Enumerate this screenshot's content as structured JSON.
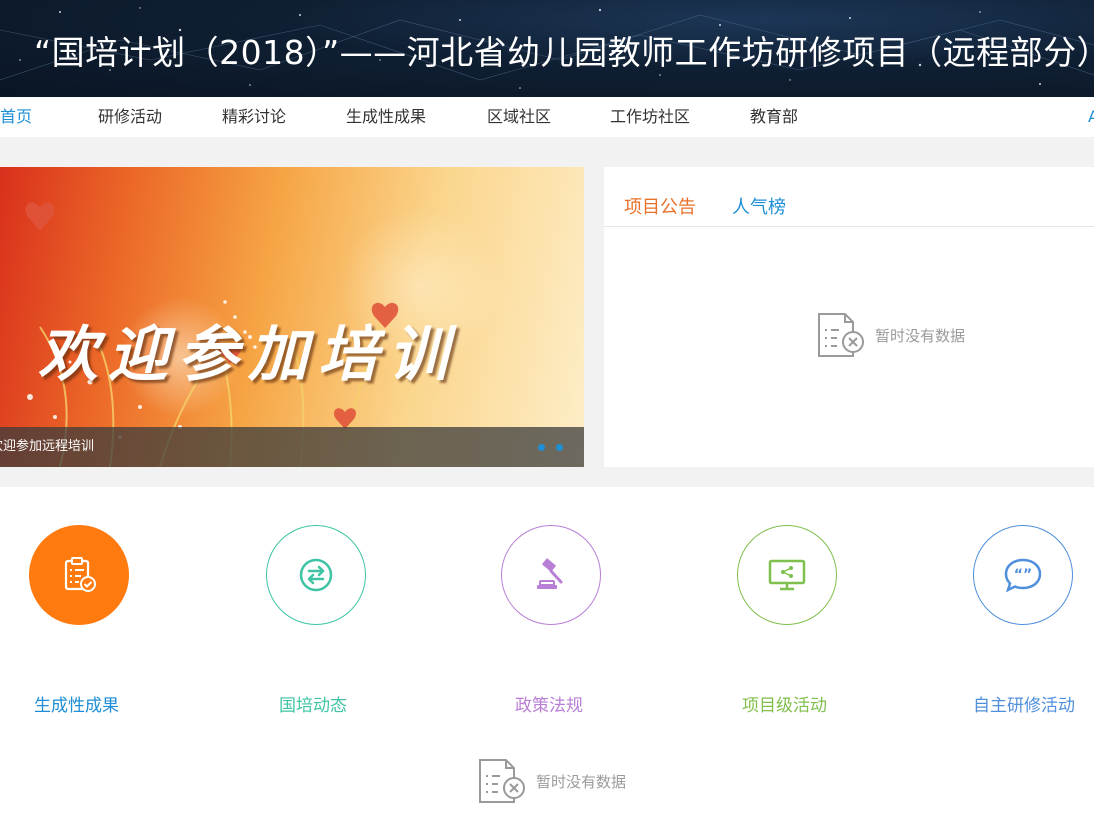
{
  "header": {
    "title": "“国培计划（2018）”——河北省幼儿园教师工作坊研修项目（远程部分）"
  },
  "nav": {
    "items": [
      {
        "label": "项目首页",
        "active": true
      },
      {
        "label": "研修活动"
      },
      {
        "label": "精彩讨论"
      },
      {
        "label": "生成性成果"
      },
      {
        "label": "区域社区"
      },
      {
        "label": "工作坊社区"
      },
      {
        "label": "教育部"
      }
    ],
    "edge_label": "A"
  },
  "banner": {
    "slogan": "欢迎参加培训",
    "caption": "欢迎参加远程培训",
    "slide_count": 2
  },
  "notice": {
    "tabs": [
      "项目公告",
      "人气榜"
    ],
    "active_tab": 0,
    "empty_text": "暂时没有数据"
  },
  "quick_links": [
    {
      "label": "生成性成果",
      "icon": "clipboard-check-icon",
      "color": "#ff7a0f",
      "filled": true,
      "label_color": "#1e8fd6"
    },
    {
      "label": "国培动态",
      "icon": "exchange-arrows-icon",
      "color": "#3ec4a4",
      "filled": false,
      "label_color": "#3ec4a4"
    },
    {
      "label": "政策法规",
      "icon": "gavel-icon",
      "color": "#b97fd6",
      "filled": false,
      "label_color": "#b97fd6"
    },
    {
      "label": "项目级活动",
      "icon": "monitor-share-icon",
      "color": "#7fbf4d",
      "filled": false,
      "label_color": "#7fbf4d"
    },
    {
      "label": "自主研修活动",
      "icon": "chat-bubble-icon",
      "color": "#4f8fdc",
      "filled": false,
      "label_color": "#4f8fdc"
    }
  ],
  "lower_empty_text": "暂时没有数据"
}
